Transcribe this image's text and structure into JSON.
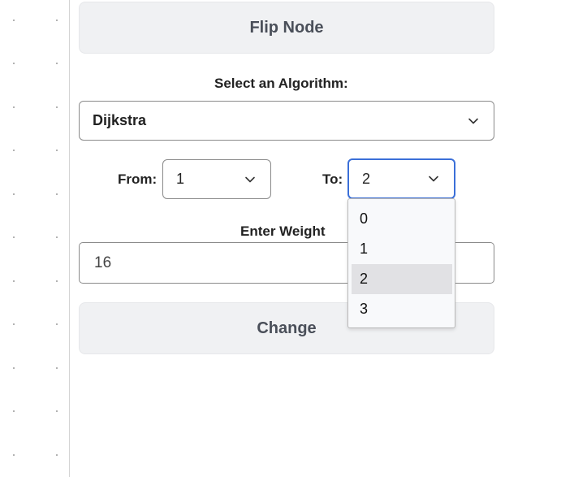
{
  "buttons": {
    "flip_node": "Flip Node",
    "change": "Change"
  },
  "algorithm": {
    "label": "Select an Algorithm:",
    "selected": "Dijkstra"
  },
  "from": {
    "label": "From:",
    "selected": "1"
  },
  "to": {
    "label": "To:",
    "selected": "2",
    "options": [
      "0",
      "1",
      "2",
      "3"
    ],
    "highlighted_option": "2"
  },
  "weight": {
    "label": "Enter Weight",
    "value": "16"
  },
  "icons": {
    "chevron": "chevron-down-icon"
  },
  "colors": {
    "focus_border": "#3b6fd8",
    "button_bg": "#f0f1f3",
    "option_highlight": "#e1e1e4"
  }
}
